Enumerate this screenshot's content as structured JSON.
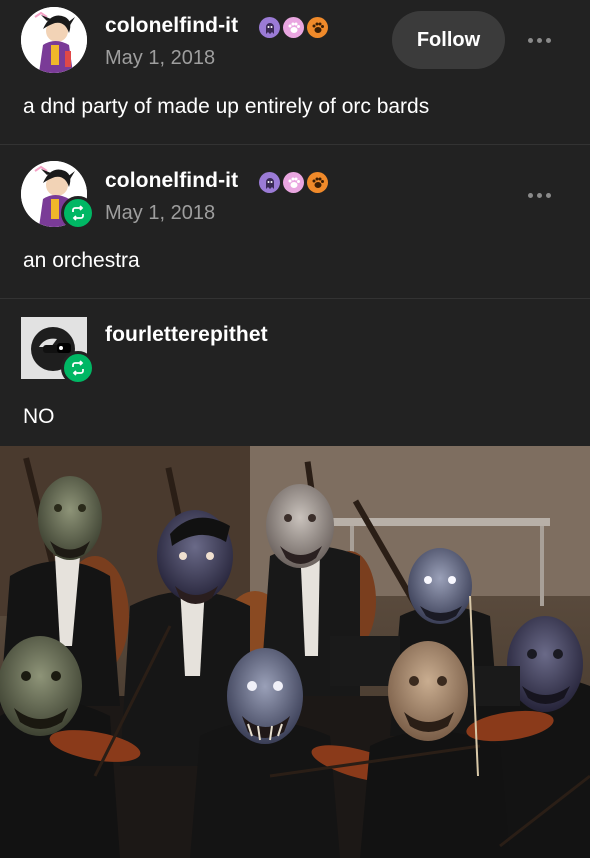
{
  "posts": [
    {
      "username": "colonelfind-it",
      "date": "May 1, 2018",
      "body": "a dnd party of made up entirely of orc bards",
      "follow_label": "Follow"
    },
    {
      "username": "colonelfind-it",
      "date": "May 1, 2018",
      "body": "an orchestra"
    },
    {
      "username": "fourletterepithet",
      "body": "NO"
    }
  ],
  "colors": {
    "background": "#222222",
    "reblog_green": "#00b764",
    "date_gray": "#9e9e9e",
    "badge_purple": "#9b7bd6",
    "badge_pink": "#e9a6e0",
    "badge_orange": "#f08a2a"
  },
  "icons": {
    "reblog": "reblog-icon",
    "more": "more-options-icon",
    "badges": [
      "ghost-badge-icon",
      "paw-badge-icon",
      "paw-badge-icon"
    ]
  },
  "image": {
    "subject": "orchestra string section with orc masks"
  }
}
